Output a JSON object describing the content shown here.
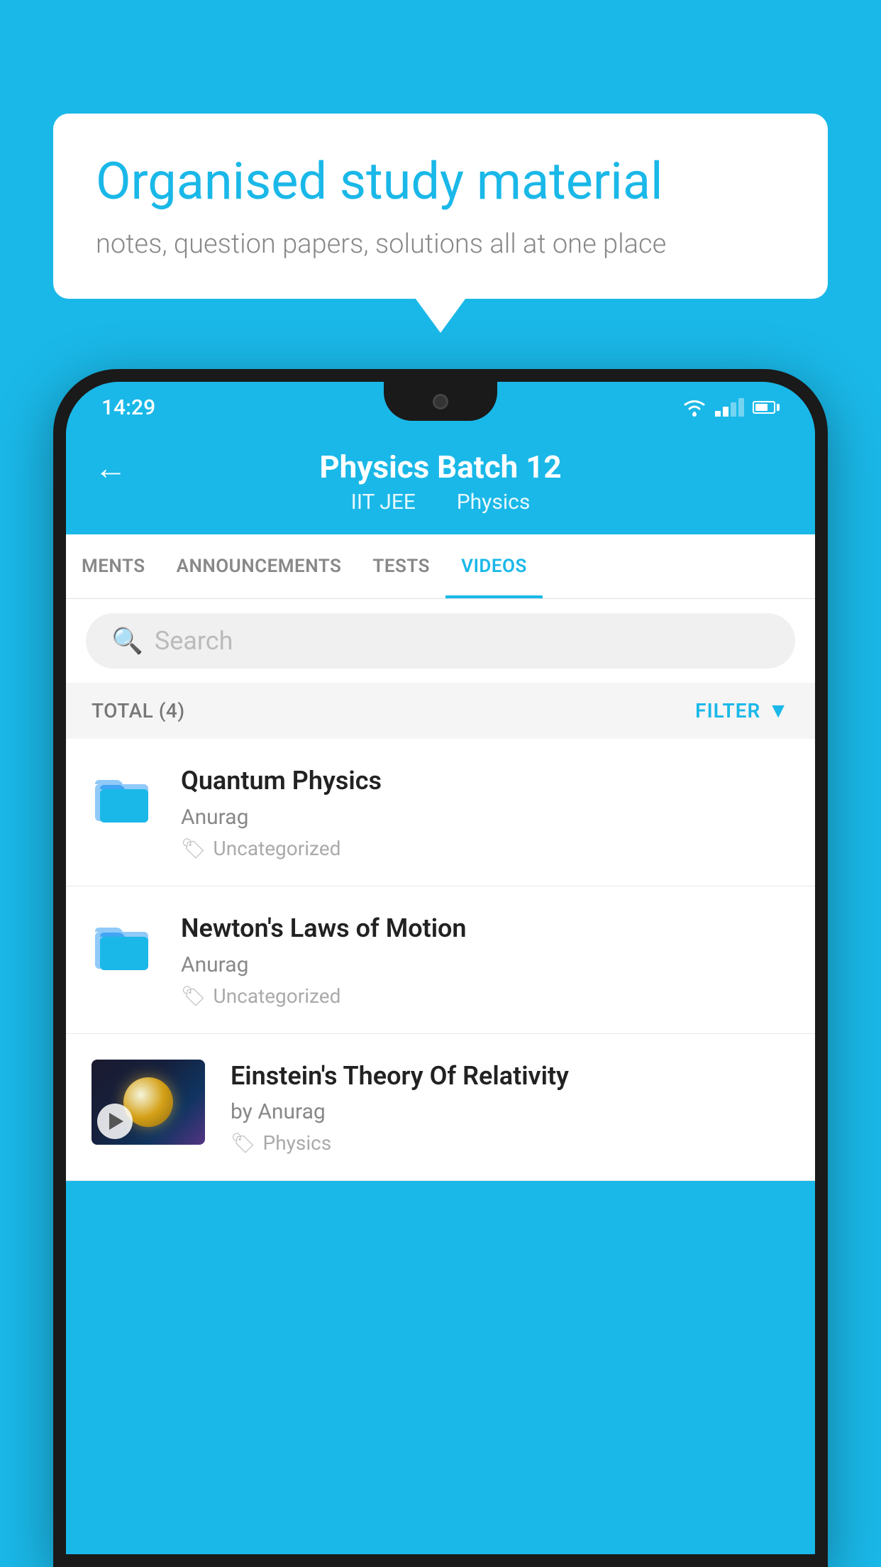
{
  "background": {
    "color": "#1ab8e8"
  },
  "hero": {
    "title": "Organised study material",
    "subtitle": "notes, question papers, solutions all at one place"
  },
  "phone": {
    "status_bar": {
      "time": "14:29"
    },
    "header": {
      "back_label": "←",
      "title": "Physics Batch 12",
      "subtitle_part1": "IIT JEE",
      "subtitle_part2": "Physics"
    },
    "tabs": [
      {
        "label": "MENTS",
        "active": false
      },
      {
        "label": "ANNOUNCEMENTS",
        "active": false
      },
      {
        "label": "TESTS",
        "active": false
      },
      {
        "label": "VIDEOS",
        "active": true
      }
    ],
    "search": {
      "placeholder": "Search"
    },
    "filter": {
      "total_label": "TOTAL (4)",
      "filter_label": "FILTER"
    },
    "videos": [
      {
        "id": 1,
        "title": "Quantum Physics",
        "author": "Anurag",
        "tag": "Uncategorized",
        "has_thumbnail": false
      },
      {
        "id": 2,
        "title": "Newton's Laws of Motion",
        "author": "Anurag",
        "tag": "Uncategorized",
        "has_thumbnail": false
      },
      {
        "id": 3,
        "title": "Einstein's Theory Of Relativity",
        "author": "by Anurag",
        "tag": "Physics",
        "has_thumbnail": true
      }
    ]
  }
}
